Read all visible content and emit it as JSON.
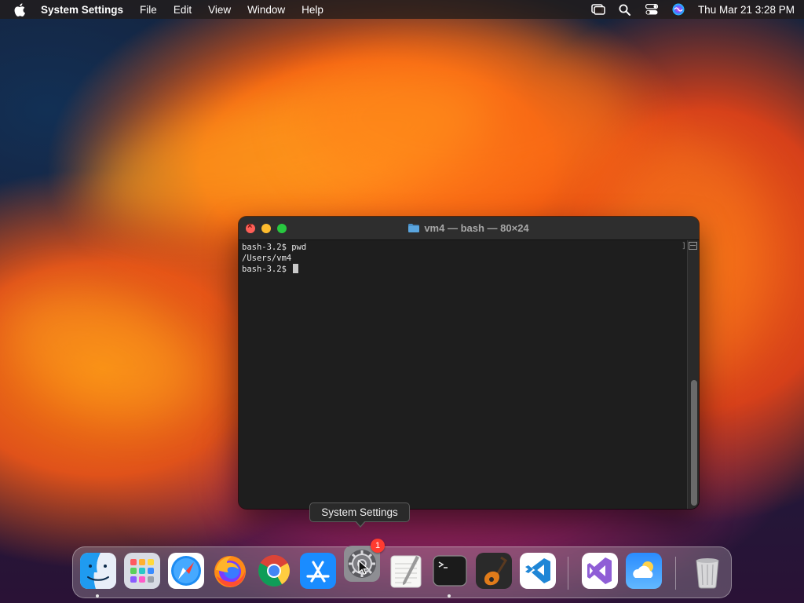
{
  "menubar": {
    "app_name": "System Settings",
    "menus": [
      "File",
      "Edit",
      "View",
      "Window",
      "Help"
    ],
    "clock": "Thu Mar 21  3:28 PM",
    "status_icons": [
      "screen-mirroring-icon",
      "search-icon",
      "control-center-icon",
      "siri-icon"
    ]
  },
  "terminal": {
    "title": "vm4 — bash — 80×24",
    "lines": [
      "bash-3.2$ pwd",
      "/Users/vm4",
      "bash-3.2$ "
    ]
  },
  "tooltip": {
    "text": "System Settings"
  },
  "dock": {
    "items": [
      {
        "app": "finder-icon",
        "running": true
      },
      {
        "app": "launchpad-icon",
        "running": false
      },
      {
        "app": "safari-icon",
        "running": false
      },
      {
        "app": "firefox-icon",
        "running": false
      },
      {
        "app": "chrome-icon",
        "running": false
      },
      {
        "app": "app-store-icon",
        "running": false
      },
      {
        "app": "system-settings-icon",
        "running": false,
        "badge": "1"
      },
      {
        "app": "textedit-icon",
        "running": false
      },
      {
        "app": "terminal-icon",
        "running": true
      },
      {
        "app": "garageband-icon",
        "running": false
      },
      {
        "app": "vscode-icon",
        "running": false
      },
      {
        "app": "visual-studio-icon",
        "running": false
      },
      {
        "app": "weather-icon",
        "running": false
      },
      {
        "app": "trash-icon",
        "running": false
      }
    ]
  },
  "colors": {
    "terminal_bg": "#1e1e1e",
    "traffic_close": "#ff5f57",
    "traffic_minimize": "#febc2e",
    "traffic_maximize": "#28c840",
    "badge": "#ff3b30"
  }
}
